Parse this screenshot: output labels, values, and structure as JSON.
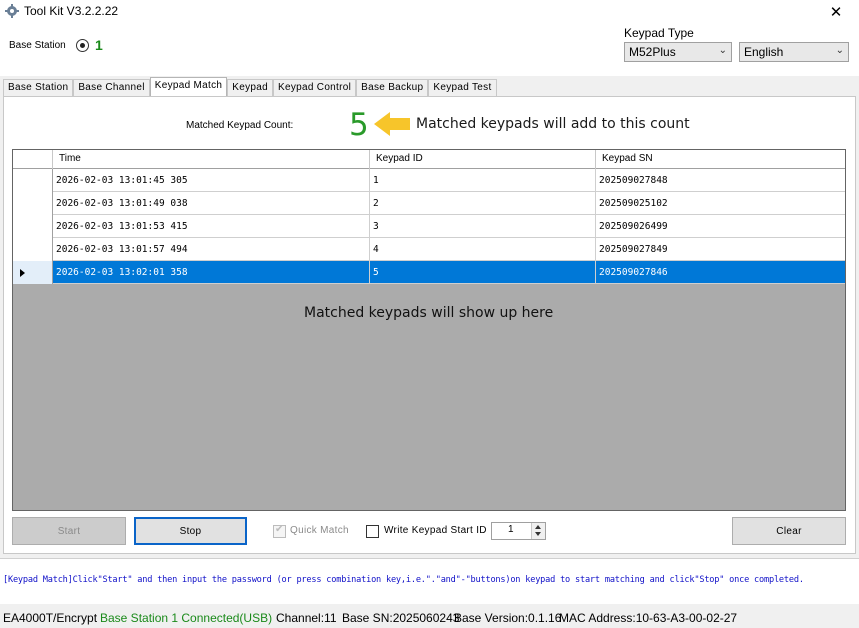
{
  "window": {
    "title": "Tool Kit  V3.2.2.22",
    "close_symbol": "✕"
  },
  "header": {
    "base_station_label": "Base Station",
    "base_station_number": "1",
    "keypad_type_label": "Keypad Type",
    "keypad_type_value": "M52Plus",
    "language_value": "English"
  },
  "tabs": [
    {
      "label": "Base Station",
      "active": false
    },
    {
      "label": "Base Channel",
      "active": false
    },
    {
      "label": "Keypad Match",
      "active": true
    },
    {
      "label": "Keypad",
      "active": false
    },
    {
      "label": "Keypad Control",
      "active": false
    },
    {
      "label": "Base Backup",
      "active": false
    },
    {
      "label": "Keypad Test",
      "active": false
    }
  ],
  "match": {
    "count_label": "Matched Keypad Count:",
    "count_value": "5",
    "count_annotation": "Matched keypads will add to this count",
    "grid_annotation": "Matched keypads will show up here"
  },
  "grid": {
    "columns": [
      "Time",
      "Keypad ID",
      "Keypad SN"
    ],
    "rows": [
      {
        "time": "2026-02-03 13:01:45 305",
        "id": "1",
        "sn": "202509027848"
      },
      {
        "time": "2026-02-03 13:01:49 038",
        "id": "2",
        "sn": "202509025102"
      },
      {
        "time": "2026-02-03 13:01:53 415",
        "id": "3",
        "sn": "202509026499"
      },
      {
        "time": "2026-02-03 13:01:57 494",
        "id": "4",
        "sn": "202509027849"
      },
      {
        "time": "2026-02-03 13:02:01 358",
        "id": "5",
        "sn": "202509027846"
      }
    ]
  },
  "controls": {
    "start_label": "Start",
    "stop_label": "Stop",
    "quick_match_label": "Quick Match",
    "write_start_id_label": "Write Keypad Start ID",
    "start_id_value": "1",
    "clear_label": "Clear"
  },
  "message": "[Keypad Match]Click\"Start\" and then input the password (or press combination key,i.e.\".\"and\"-\"buttons)on keypad to start matching and click\"Stop\" once completed.",
  "status": {
    "model": "EA4000T/Encrypt",
    "connection": "Base Station 1 Connected(USB)",
    "channel": "Channel:11",
    "base_sn": "Base SN:2025060243",
    "base_version": "Base Version:0.1.16",
    "mac": "MAC Address:10-63-A3-00-02-27"
  },
  "colors": {
    "selection": "#0078d7",
    "status_green": "#1a8a1a",
    "message_blue": "#1010c8",
    "arrow_yellow": "#f7c52a"
  }
}
